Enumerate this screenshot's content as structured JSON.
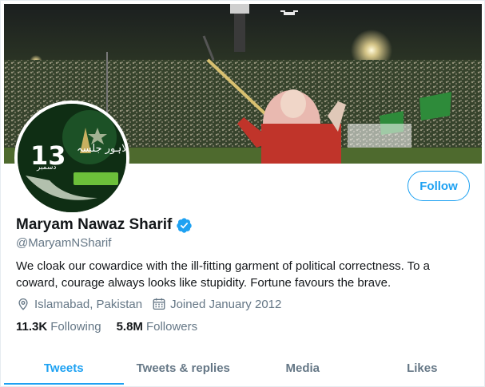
{
  "profile": {
    "name": "Maryam Nawaz Sharif",
    "handle": "@MaryamNSharif",
    "bio": "We cloak our cowardice with the ill-fitting garment of political correctness. To a coward, courage always looks like stupidity. Fortune favours the brave.",
    "location": "Islamabad, Pakistan",
    "joined": "Joined January 2012",
    "verified": true
  },
  "avatar": {
    "number": "13",
    "urdu_top": "لاہور جلسہ",
    "urdu_bottom": "دسمبر"
  },
  "stats": {
    "following_count": "11.3K",
    "following_label": "Following",
    "followers_count": "5.8M",
    "followers_label": "Followers"
  },
  "follow_button": "Follow",
  "tabs": [
    {
      "label": "Tweets",
      "active": true
    },
    {
      "label": "Tweets & replies",
      "active": false
    },
    {
      "label": "Media",
      "active": false
    },
    {
      "label": "Likes",
      "active": false
    }
  ],
  "colors": {
    "accent": "#1da1f2",
    "secondary_text": "#657786",
    "primary_text": "#14171a"
  },
  "icons": {
    "verified": "verified-badge-icon",
    "location": "location-pin-icon",
    "calendar": "calendar-icon"
  }
}
